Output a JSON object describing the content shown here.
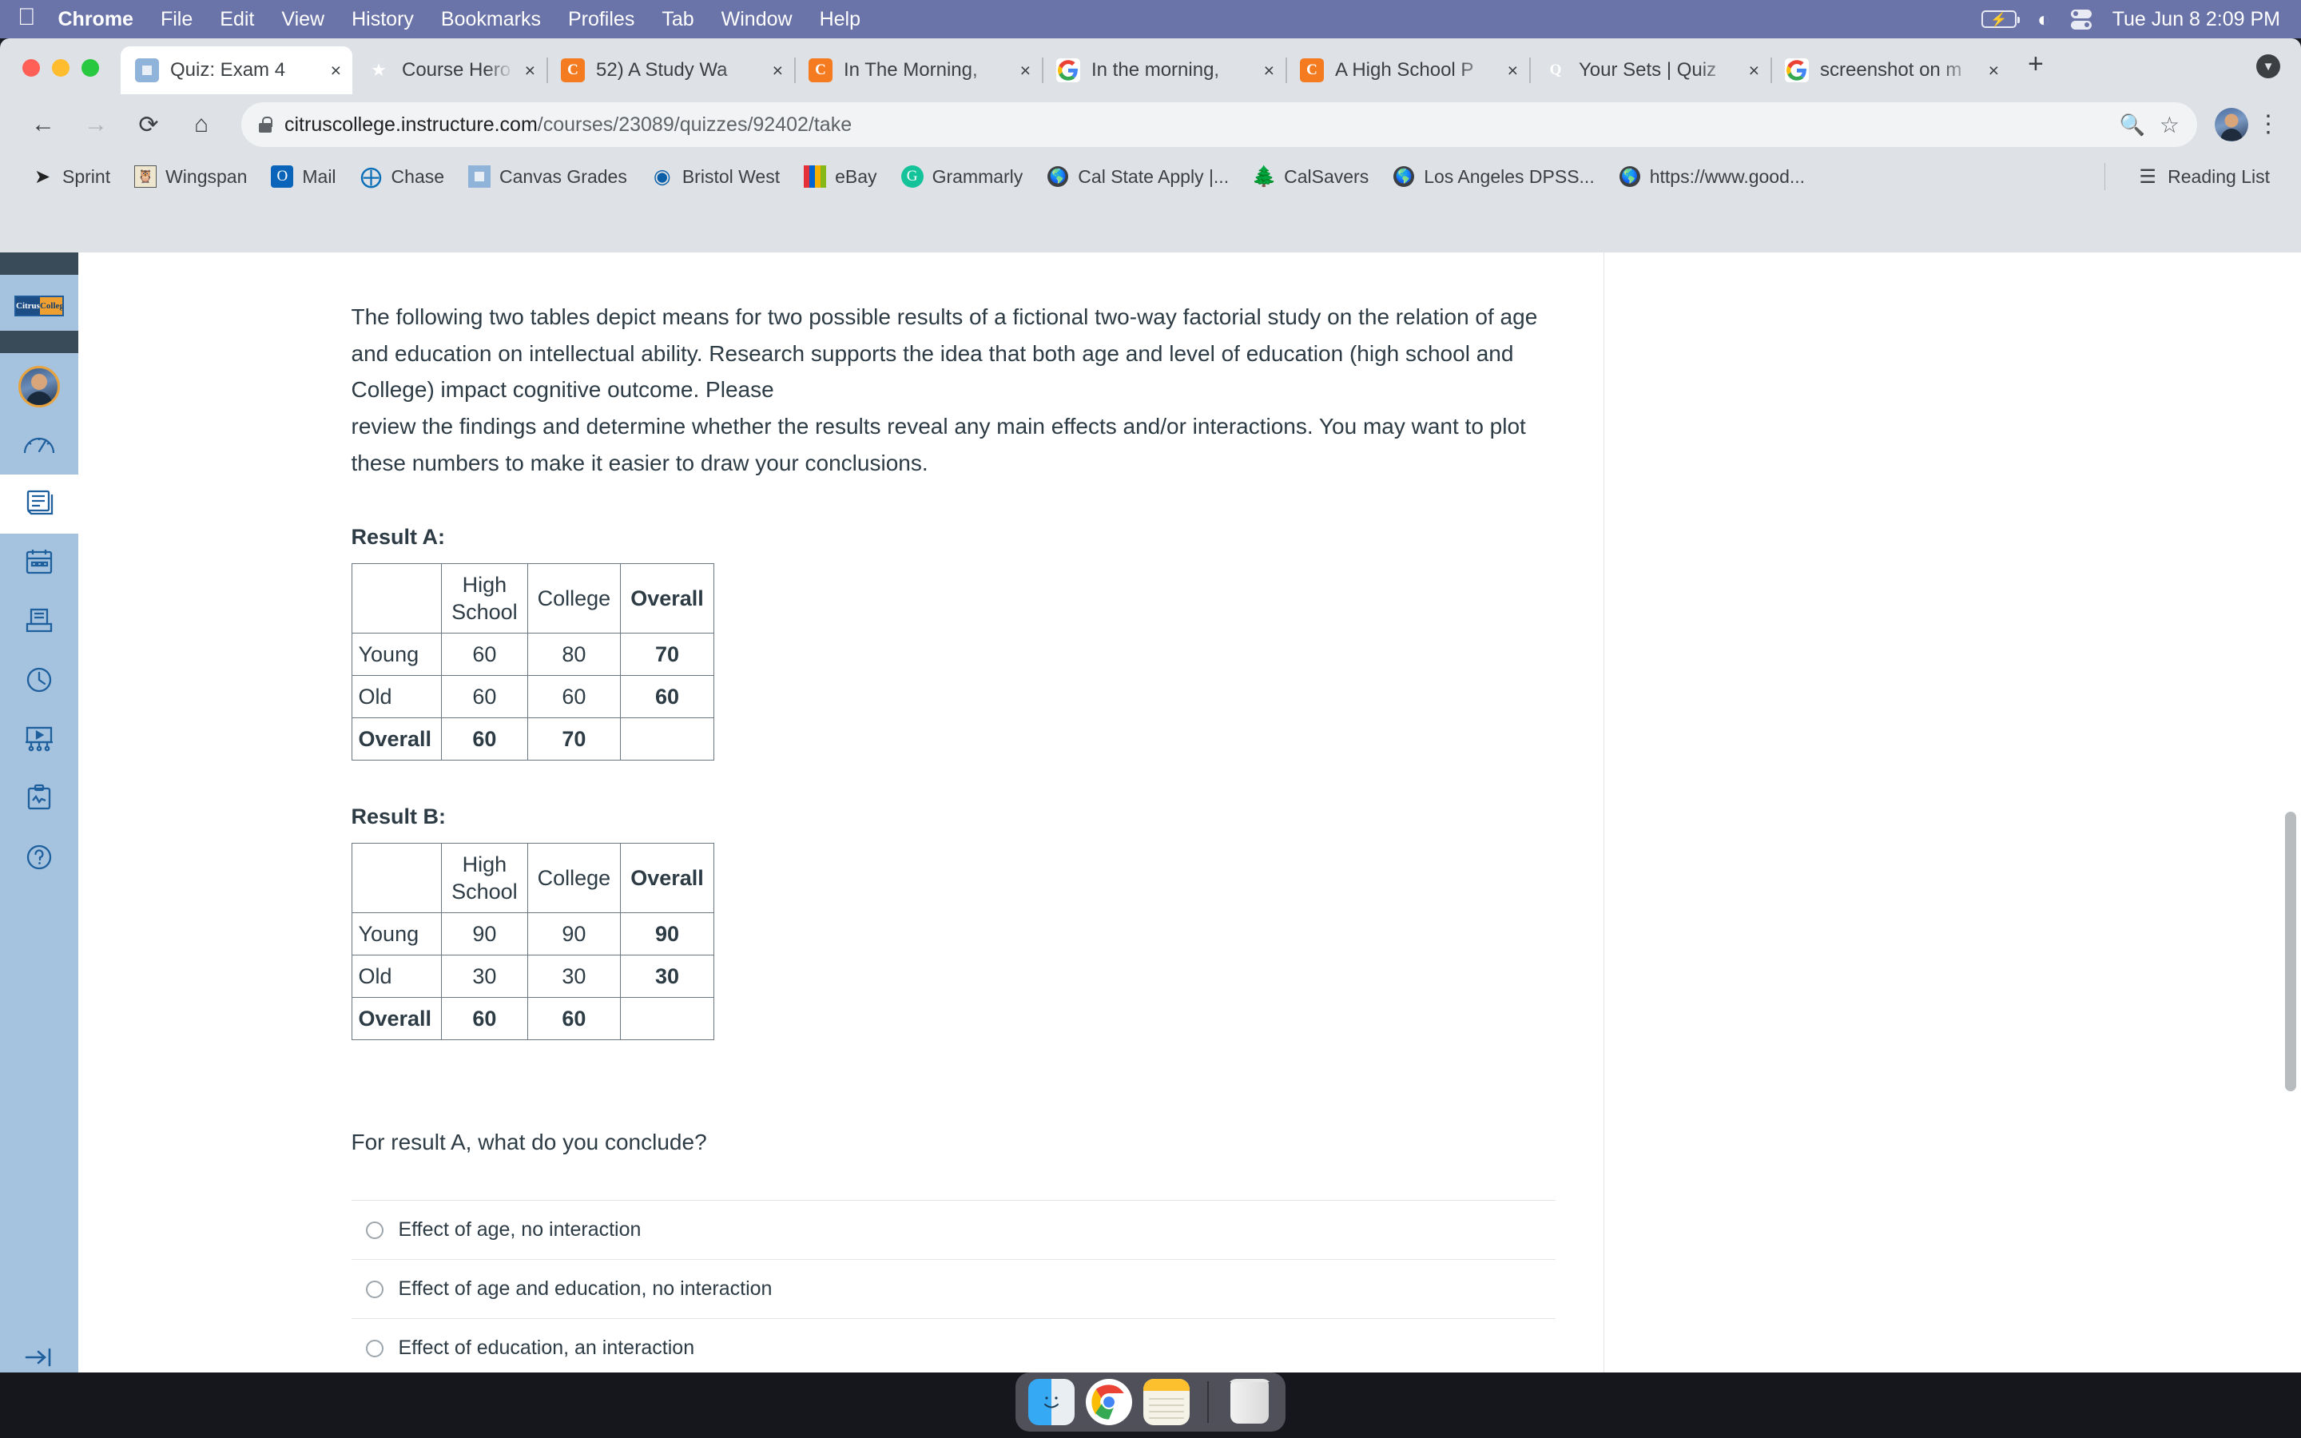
{
  "menubar": {
    "apple_icon": "apple-logo",
    "items": [
      "Chrome",
      "File",
      "Edit",
      "View",
      "History",
      "Bookmarks",
      "Profiles",
      "Tab",
      "Window",
      "Help"
    ],
    "status": {
      "battery_icon": "battery-charging-icon",
      "wifi_icon": "wifi-icon",
      "control_center_icon": "control-center-icon",
      "clock": "Tue Jun 8  2:09 PM"
    }
  },
  "browser": {
    "tabs": [
      {
        "title": "Quiz: Exam 4",
        "favicon": "canvas-icon",
        "active": true,
        "close": "×"
      },
      {
        "title": "Course Hero",
        "favicon": "coursehero-icon",
        "active": false,
        "close": "×"
      },
      {
        "title": "52) A Study Wa",
        "favicon": "coursehero-c-icon",
        "active": false,
        "close": "×"
      },
      {
        "title": "In The Morning,",
        "favicon": "coursehero-c-icon",
        "active": false,
        "close": "×"
      },
      {
        "title": "In the morning,",
        "favicon": "google-icon",
        "active": false,
        "close": "×"
      },
      {
        "title": "A High School P",
        "favicon": "coursehero-c-icon",
        "active": false,
        "close": "×"
      },
      {
        "title": "Your Sets | Quiz",
        "favicon": "quizlet-icon",
        "active": false,
        "close": "×"
      },
      {
        "title": "screenshot on m",
        "favicon": "google-icon",
        "active": false,
        "close": "×"
      }
    ],
    "new_tab_label": "+",
    "tab_list_icon": "chevron-down-icon",
    "toolbar": {
      "back_icon": "back-arrow-icon",
      "forward_icon": "forward-arrow-icon",
      "reload_icon": "reload-icon",
      "home_icon": "home-icon",
      "lock_icon": "lock-icon",
      "url_host": "citruscollege.instructure.com",
      "url_path": "/courses/23089/quizzes/92402/take",
      "search_icon": "search-icon",
      "bookmark_star_icon": "star-icon",
      "profile_icon": "profile-avatar",
      "menu_icon": "kebab-menu-icon"
    },
    "bookmarks": [
      {
        "label": "Sprint",
        "icon": "sprint-icon"
      },
      {
        "label": "Wingspan",
        "icon": "wingspan-icon"
      },
      {
        "label": "Mail",
        "icon": "outlook-icon"
      },
      {
        "label": "Chase",
        "icon": "chase-icon"
      },
      {
        "label": "Canvas Grades",
        "icon": "canvas-icon"
      },
      {
        "label": "Bristol West",
        "icon": "bristolwest-icon"
      },
      {
        "label": "eBay",
        "icon": "ebay-icon"
      },
      {
        "label": "Grammarly",
        "icon": "grammarly-icon"
      },
      {
        "label": "Cal State Apply |...",
        "icon": "globe-icon"
      },
      {
        "label": "CalSavers",
        "icon": "calsavers-tree-icon"
      },
      {
        "label": "Los Angeles DPSS...",
        "icon": "globe-icon"
      },
      {
        "label": "https://www.good...",
        "icon": "globe-icon"
      }
    ],
    "reading_list": {
      "label": "Reading List",
      "icon": "reading-list-icon"
    }
  },
  "canvas_nav": {
    "logo_left": "Citrus",
    "logo_right": "College",
    "items": [
      {
        "name": "account",
        "icon": "user-avatar-icon"
      },
      {
        "name": "dashboard",
        "icon": "dashboard-gauge-icon"
      },
      {
        "name": "courses",
        "icon": "book-icon",
        "active": true
      },
      {
        "name": "calendar",
        "icon": "calendar-icon"
      },
      {
        "name": "inbox",
        "icon": "inbox-icon"
      },
      {
        "name": "history",
        "icon": "clock-icon"
      },
      {
        "name": "studio",
        "icon": "studio-video-icon"
      },
      {
        "name": "commons",
        "icon": "commons-clipboard-icon"
      },
      {
        "name": "help",
        "icon": "help-question-icon"
      }
    ],
    "collapse_icon": "collapse-arrow-icon"
  },
  "quiz": {
    "intro": [
      "The following two tables depict means for two possible results of a fictional two-way factorial study on the relation of age and education on intellectual ability.  Research supports the idea that both age and level of education (high school and College) impact cognitive outcome.  Please",
      "review the findings and determine whether the results reveal any main effects and/or interactions.  You may want to plot these numbers to make it easier to draw your conclusions."
    ],
    "result_a": {
      "label": "Result A:",
      "headers": [
        "",
        "High School",
        "College",
        "Overall"
      ],
      "rows": [
        {
          "label": "Young",
          "hs": "60",
          "college": "80",
          "overall": "70"
        },
        {
          "label": "Old",
          "hs": "60",
          "college": "60",
          "overall": "60"
        },
        {
          "label": "Overall",
          "hs": "60",
          "college": "70",
          "overall": ""
        }
      ]
    },
    "result_b": {
      "label": "Result B:",
      "headers": [
        "",
        "High School",
        "College",
        "Overall"
      ],
      "rows": [
        {
          "label": "Young",
          "hs": "90",
          "college": "90",
          "overall": "90"
        },
        {
          "label": "Old",
          "hs": "30",
          "college": "30",
          "overall": "30"
        },
        {
          "label": "Overall",
          "hs": "60",
          "college": "60",
          "overall": ""
        }
      ]
    },
    "question": "For result A, what do you conclude?",
    "answers": [
      "Effect of age, no interaction",
      "Effect of age and education, no interaction",
      "Effect of education, an interaction"
    ]
  },
  "dock": {
    "items": [
      {
        "name": "finder",
        "icon": "finder-icon",
        "running": true
      },
      {
        "name": "chrome",
        "icon": "chrome-icon",
        "running": true
      },
      {
        "name": "notes",
        "icon": "notes-icon",
        "running": true
      },
      {
        "name": "trash",
        "icon": "trash-icon",
        "running": false
      }
    ]
  },
  "colors": {
    "menubar": "#6b74a8",
    "chrome_chrome": "#dee1e6",
    "canvas_nav": "#a5c3df",
    "canvas_accent": "#1e5f9e",
    "text": "#2d3b45"
  }
}
